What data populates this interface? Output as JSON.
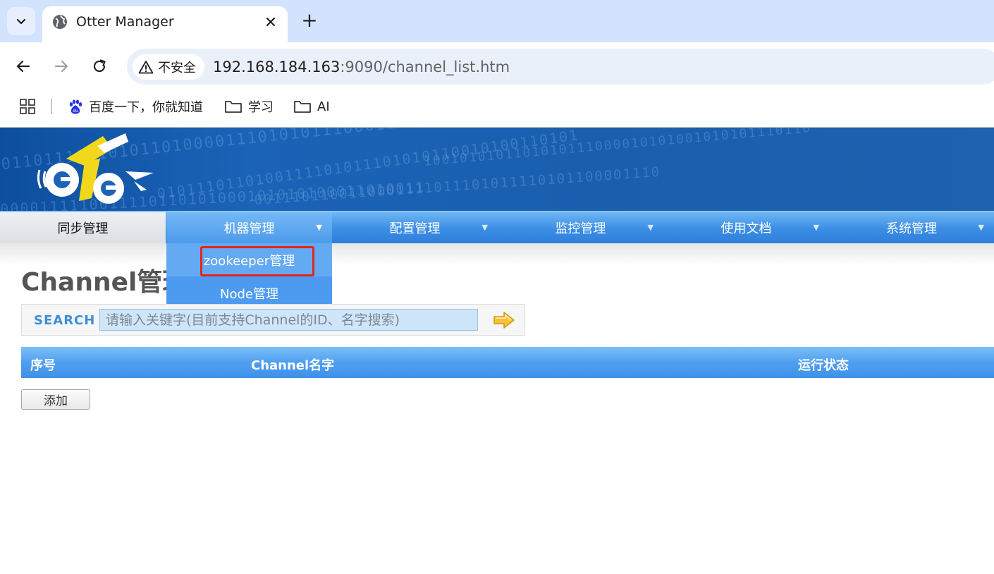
{
  "browser": {
    "tab_title": "Otter Manager",
    "tab_close": "✕",
    "new_tab": "+",
    "security_label": "不安全",
    "url_host": "192.168.184.163",
    "url_rest": ":9090/channel_list.htm",
    "bookmarks": [
      {
        "label": "百度一下，你就知道",
        "icon": "baidu-icon"
      },
      {
        "label": "学习",
        "icon": "folder-icon"
      },
      {
        "label": "AI",
        "icon": "folder-icon"
      }
    ]
  },
  "banner": {
    "bits": [
      "0110111101010110100001110101011100011101010",
      "0101110110100111101011101010110010100110101",
      "0011101100110001111011101011110101100001110",
      "1001010101101010111000010101001010101110110",
      "0000111110011110110101000101010100011010011"
    ]
  },
  "menu": {
    "items": [
      {
        "label": "同步管理",
        "arrow": ""
      },
      {
        "label": "机器管理",
        "arrow": "▼"
      },
      {
        "label": "配置管理",
        "arrow": "▼"
      },
      {
        "label": "监控管理",
        "arrow": "▼"
      },
      {
        "label": "使用文档",
        "arrow": "▼"
      },
      {
        "label": "系统管理",
        "arrow": "▼"
      }
    ],
    "dropdown": [
      "zookeeper管理",
      "Node管理"
    ]
  },
  "main": {
    "title": "Channel管理",
    "search_label": "SEARCH",
    "search_placeholder": "请输入关键字(目前支持Channel的ID、名字搜索)",
    "table_headers": [
      "序号",
      "Channel名字",
      "运行状态"
    ],
    "add_button": "添加"
  },
  "colors": {
    "menu_blue": "#3b8de4",
    "highlight_red": "#e8231b",
    "banner_blue": "#1b63b7"
  }
}
